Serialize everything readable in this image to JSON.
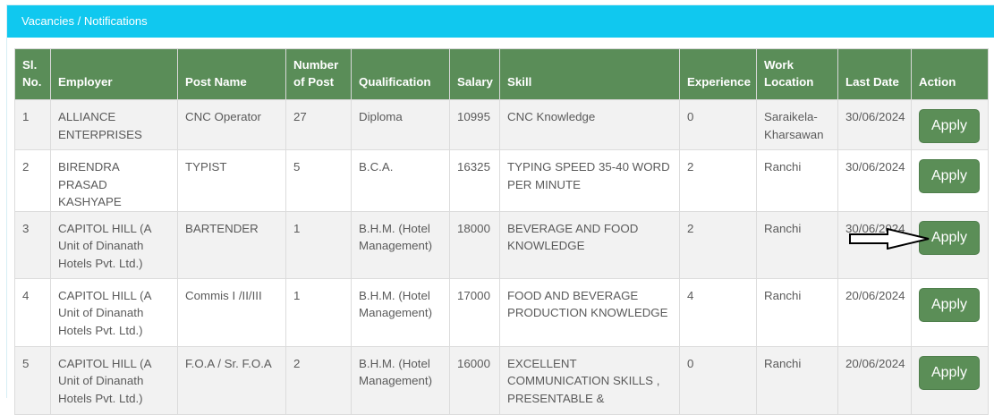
{
  "panel": {
    "title": "Vacancies / Notifications"
  },
  "table": {
    "headers": [
      "Sl.\nNo.",
      "Employer",
      "Post Name",
      "Number\nof Post",
      "Qualification",
      "Salary",
      "Skill",
      "Experience",
      "Work\nLocation",
      "Last Date",
      "Action"
    ],
    "rows": [
      {
        "sl": "1",
        "employer": "ALLIANCE ENTERPRISES",
        "post": "CNC Operator",
        "count": "27",
        "qualification": "Diploma",
        "salary": "10995",
        "skill": "CNC Knowledge",
        "experience": "0",
        "location": "Saraikela-Kharsawan",
        "last_date": "30/06/2024",
        "action": "Apply"
      },
      {
        "sl": "2",
        "employer": "BIRENDRA PRASAD KASHYAPE",
        "post": "TYPIST",
        "count": "5",
        "qualification": "B.C.A.",
        "salary": "16325",
        "skill": "TYPING SPEED 35-40 WORD PER MINUTE",
        "experience": "2",
        "location": "Ranchi",
        "last_date": "30/06/2024",
        "action": "Apply"
      },
      {
        "sl": "3",
        "employer": "CAPITOL HILL (A Unit of Dinanath Hotels Pvt. Ltd.)",
        "post": "BARTENDER",
        "count": "1",
        "qualification": "B.H.M. (Hotel Management)",
        "salary": "18000",
        "skill": "BEVERAGE AND FOOD KNOWLEDGE",
        "experience": "2",
        "location": "Ranchi",
        "last_date": "30/06/2024",
        "action": "Apply"
      },
      {
        "sl": "4",
        "employer": "CAPITOL HILL (A Unit of Dinanath Hotels Pvt. Ltd.)",
        "post": "Commis I /II/III",
        "count": "1",
        "qualification": "B.H.M. (Hotel Management)",
        "salary": "17000",
        "skill": "FOOD AND BEVERAGE PRODUCTION KNOWLEDGE",
        "experience": "4",
        "location": "Ranchi",
        "last_date": "20/06/2024",
        "action": "Apply"
      },
      {
        "sl": "5",
        "employer": "CAPITOL HILL (A Unit of Dinanath Hotels Pvt. Ltd.)",
        "post": "F.O.A / Sr. F.O.A",
        "count": "2",
        "qualification": "B.H.M. (Hotel Management)",
        "salary": "16000",
        "skill": "EXCELLENT COMMUNICATION SKILLS , PRESENTABLE &",
        "experience": "0",
        "location": "Ranchi",
        "last_date": "20/06/2024",
        "action": "Apply"
      }
    ]
  },
  "annotation": {
    "icon": "arrow-right-icon"
  },
  "colors": {
    "heading_bg": "#10c8ef",
    "table_header_bg": "#5a8d58",
    "button_bg": "#5b8e57"
  }
}
